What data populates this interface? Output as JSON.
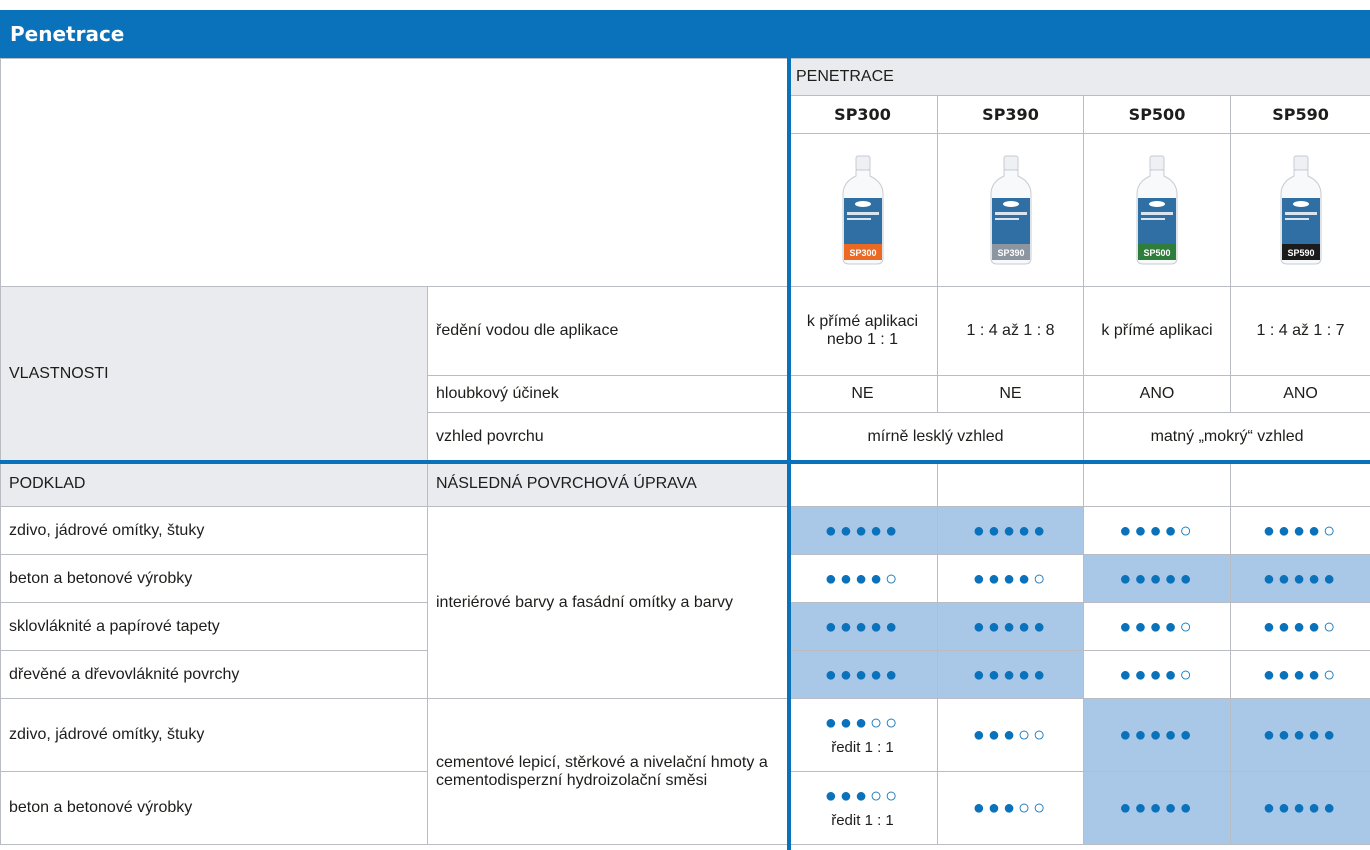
{
  "title": "Penetrace",
  "group_label": "PENETRACE",
  "products": [
    {
      "name": "SP300",
      "label_color": "#ea6a24",
      "code": "SP300"
    },
    {
      "name": "SP390",
      "label_color": "#8c96a0",
      "code": "SP390"
    },
    {
      "name": "SP500",
      "label_color": "#2e7d3a",
      "code": "SP500"
    },
    {
      "name": "SP590",
      "label_color": "#1b1b1b",
      "code": "SP590"
    }
  ],
  "properties": {
    "section": "VLASTNOSTI",
    "rows": [
      {
        "label": "ředění vodou dle aplikace",
        "values": [
          "k přímé aplikaci nebo 1 : 1",
          "1 : 4 až 1 : 8",
          "k přímé aplikaci",
          "1 : 4 až 1 : 7"
        ]
      },
      {
        "label": "hloubkový účinek",
        "values": [
          "NE",
          "NE",
          "ANO",
          "ANO"
        ]
      },
      {
        "label": "vzhled povrchu",
        "values": [
          "mírně lesklý vzhled",
          "matný „mokrý“ vzhled"
        ]
      }
    ]
  },
  "matrix": {
    "col_podklad": "PODKLAD",
    "col_uprava": "NÁSLEDNÁ POVRCHOVÁ ÚPRAVA",
    "group1_label": "interiérové barvy a fasádní omítky a barvy",
    "group2_label": "cementové lepicí, stěrkové a nivelační hmoty a cementodisperzní hydroizolační směsi",
    "rows": [
      {
        "podklad": "zdivo, jádrové omítky, štuky",
        "cells": [
          {
            "dots": "●●●●●",
            "hi": true
          },
          {
            "dots": "●●●●●",
            "hi": true
          },
          {
            "dots": "●●●●○",
            "hi": false
          },
          {
            "dots": "●●●●○",
            "hi": false
          }
        ]
      },
      {
        "podklad": "beton a betonové výrobky",
        "cells": [
          {
            "dots": "●●●●○",
            "hi": false
          },
          {
            "dots": "●●●●○",
            "hi": false
          },
          {
            "dots": "●●●●●",
            "hi": true
          },
          {
            "dots": "●●●●●",
            "hi": true
          }
        ]
      },
      {
        "podklad": "sklovláknité a papírové tapety",
        "cells": [
          {
            "dots": "●●●●●",
            "hi": true
          },
          {
            "dots": "●●●●●",
            "hi": true
          },
          {
            "dots": "●●●●○",
            "hi": false
          },
          {
            "dots": "●●●●○",
            "hi": false
          }
        ]
      },
      {
        "podklad": "dřevěné a dřevovláknité povrchy",
        "cells": [
          {
            "dots": "●●●●●",
            "hi": true
          },
          {
            "dots": "●●●●●",
            "hi": true
          },
          {
            "dots": "●●●●○",
            "hi": false
          },
          {
            "dots": "●●●●○",
            "hi": false
          }
        ]
      },
      {
        "podklad": "zdivo, jádrové omítky, štuky",
        "cells": [
          {
            "dots": "●●●○○",
            "note": "ředit 1 : 1",
            "hi": false
          },
          {
            "dots": "●●●○○",
            "hi": false
          },
          {
            "dots": "●●●●●",
            "hi": true
          },
          {
            "dots": "●●●●●",
            "hi": true
          }
        ]
      },
      {
        "podklad": "beton a betonové výrobky",
        "cells": [
          {
            "dots": "●●●○○",
            "note": "ředit 1 : 1",
            "hi": false
          },
          {
            "dots": "●●●○○",
            "hi": false
          },
          {
            "dots": "●●●●●",
            "hi": true
          },
          {
            "dots": "●●●●●",
            "hi": true
          }
        ]
      }
    ]
  }
}
